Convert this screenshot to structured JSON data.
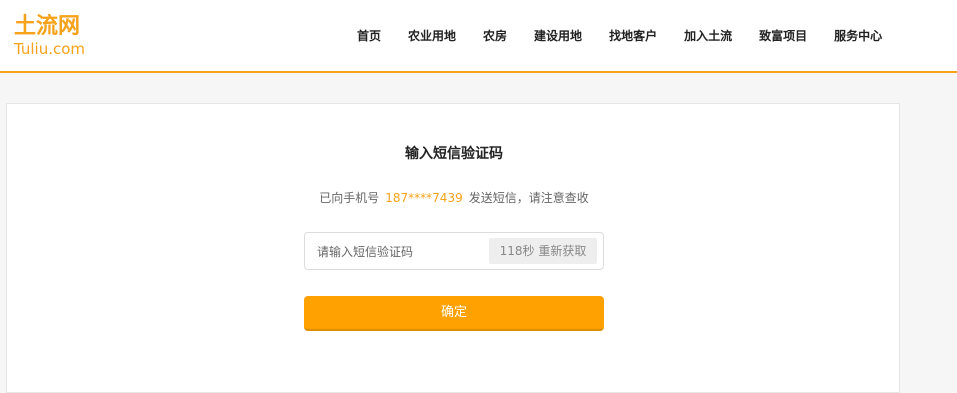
{
  "brand": {
    "name_cn": "土流网",
    "name_en": "Tuliu.com",
    "accent_color": "#f7a21b"
  },
  "nav": {
    "items": [
      "首页",
      "农业用地",
      "农房",
      "建设用地",
      "找地客户",
      "加入土流",
      "致富项目",
      "服务中心"
    ]
  },
  "verify": {
    "title": "输入短信验证码",
    "notice_prefix": "已向手机号",
    "phone": "187****7439",
    "notice_suffix": "发送短信，请注意查收",
    "code_placeholder": "请输入短信验证码",
    "resend_label": "118秒 重新获取",
    "confirm_label": "确定",
    "button_color": "#ffa100"
  }
}
